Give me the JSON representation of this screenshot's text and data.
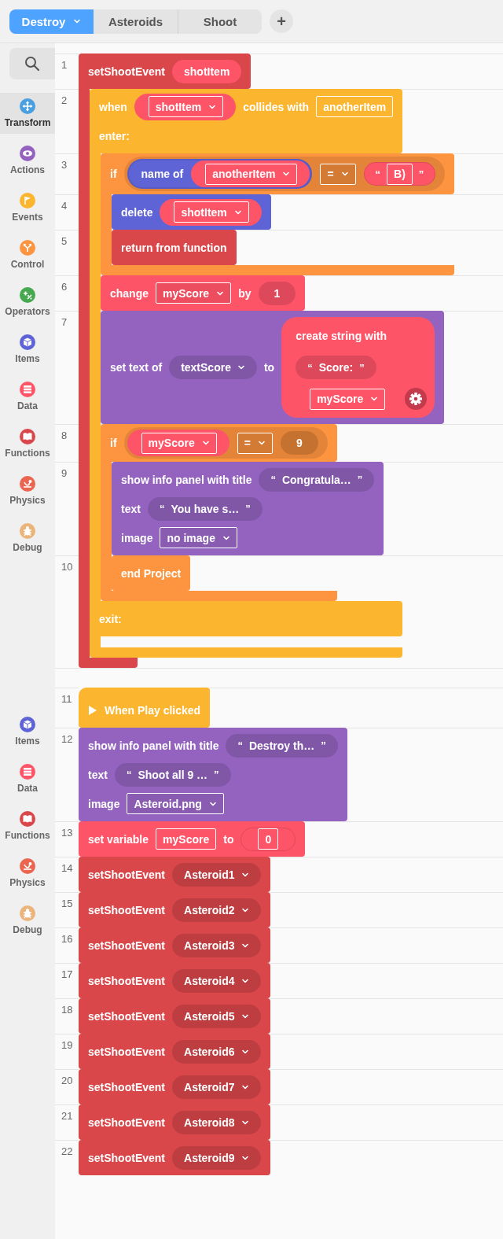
{
  "tabs": [
    {
      "label": "Destroy",
      "selected": true,
      "menu": true
    },
    {
      "label": "Asteroids",
      "selected": false,
      "menu": false
    },
    {
      "label": "Shoot",
      "selected": false,
      "menu": false
    }
  ],
  "add_tab": "+",
  "sidebar": {
    "items": [
      {
        "label": "Transform",
        "kind": "transform",
        "color": "#4a9fe0",
        "selected": true
      },
      {
        "label": "Actions",
        "kind": "actions",
        "color": "#9463c0",
        "selected": false
      },
      {
        "label": "Events",
        "kind": "events",
        "color": "#fbb52e",
        "selected": false
      },
      {
        "label": "Control",
        "kind": "control",
        "color": "#fd9440",
        "selected": false
      },
      {
        "label": "Operators",
        "kind": "operators",
        "color": "#46a84f",
        "selected": false
      },
      {
        "label": "Items",
        "kind": "items",
        "color": "#5e63d6",
        "selected": false
      },
      {
        "label": "Data",
        "kind": "data",
        "color": "#fe5468",
        "selected": false
      },
      {
        "label": "Functions",
        "kind": "functions",
        "color": "#d9474b",
        "selected": false
      },
      {
        "label": "Physics",
        "kind": "physics",
        "color": "#ea6650",
        "selected": false
      },
      {
        "label": "Debug",
        "kind": "debug",
        "color": "#eab47a",
        "selected": false
      }
    ],
    "more_items": [
      {
        "label": "Items",
        "kind": "items",
        "color": "#5e63d6",
        "selected": false
      },
      {
        "label": "Data",
        "kind": "data",
        "color": "#fe5468",
        "selected": false
      },
      {
        "label": "Functions",
        "kind": "functions",
        "color": "#d9474b",
        "selected": false
      },
      {
        "label": "Physics",
        "kind": "physics",
        "color": "#ea6650",
        "selected": false
      },
      {
        "label": "Debug",
        "kind": "debug",
        "color": "#eab47a",
        "selected": false
      }
    ]
  },
  "scripts": [
    {
      "blocks": [
        {
          "line": "1",
          "color": "#d9474b",
          "kind": "definition",
          "rows": [
            [
              {
                "kind": "label",
                "text": "setShootEvent"
              },
              {
                "kind": "param",
                "text": "shotItem"
              }
            ]
          ],
          "body": [
            {
              "line": "2",
              "color": "#fbb52e",
              "kind": "container",
              "rows": [
                [
                  {
                    "kind": "label",
                    "text": "when"
                  },
                  {
                    "kind": "var_dropdown",
                    "text": "shotItem"
                  },
                  {
                    "kind": "label",
                    "text": "collides with"
                  },
                  {
                    "kind": "field",
                    "text": "anotherItem"
                  }
                ],
                [
                  {
                    "kind": "label",
                    "text": "enter:"
                  }
                ]
              ],
              "body": [
                {
                  "line": "3",
                  "color": "#fd9440",
                  "kind": "container",
                  "rows": [
                    [
                      {
                        "kind": "label",
                        "text": "if"
                      },
                      {
                        "kind": "condition",
                        "parts": [
                          {
                            "kind": "reporter",
                            "color": "#5e63d6",
                            "parts": [
                              {
                                "kind": "label",
                                "text": "name of"
                              },
                              {
                                "kind": "var_dropdown",
                                "text": "anotherItem"
                              }
                            ]
                          },
                          {
                            "kind": "dropdown",
                            "text": "="
                          },
                          {
                            "kind": "string_field",
                            "quote_open": "“",
                            "text": "B)",
                            "quote_close": "”"
                          }
                        ]
                      }
                    ]
                  ],
                  "body": [
                    {
                      "line": "4",
                      "color": "#5e63d6",
                      "kind": "statement",
                      "rows": [
                        [
                          {
                            "kind": "label",
                            "text": "delete"
                          },
                          {
                            "kind": "var_dropdown",
                            "text": "shotItem"
                          }
                        ]
                      ]
                    },
                    {
                      "line": "5",
                      "color": "#d9474b",
                      "kind": "statement",
                      "rows": [
                        [
                          {
                            "kind": "label",
                            "text": "return from function"
                          }
                        ]
                      ]
                    }
                  ]
                },
                {
                  "line": "6",
                  "color": "#fe5468",
                  "kind": "statement",
                  "rows": [
                    [
                      {
                        "kind": "label",
                        "text": "change"
                      },
                      {
                        "kind": "dropdown",
                        "text": "myScore"
                      },
                      {
                        "kind": "label",
                        "text": "by"
                      },
                      {
                        "kind": "number",
                        "text": "1"
                      }
                    ]
                  ]
                },
                {
                  "line": "7",
                  "color": "#9463c0",
                  "kind": "statement",
                  "rows": [
                    [
                      {
                        "kind": "label",
                        "text": "set text of"
                      },
                      {
                        "kind": "dropdown_pill",
                        "text": "textScore"
                      },
                      {
                        "kind": "label",
                        "text": "to"
                      },
                      {
                        "kind": "reporter_rows",
                        "color": "#fe5468",
                        "rows": [
                          [
                            {
                              "kind": "label",
                              "text": "create string with"
                            }
                          ],
                          [
                            {
                              "kind": "string",
                              "quote_open": "“",
                              "text": "Score:",
                              "quote_close": "”"
                            }
                          ],
                          [
                            {
                              "kind": "var_dropdown",
                              "text": "myScore"
                            },
                            {
                              "kind": "gear"
                            }
                          ]
                        ]
                      }
                    ]
                  ]
                },
                {
                  "line": "8",
                  "color": "#fd9440",
                  "kind": "container",
                  "rows": [
                    [
                      {
                        "kind": "label",
                        "text": "if"
                      },
                      {
                        "kind": "condition",
                        "parts": [
                          {
                            "kind": "var_dropdown",
                            "text": "myScore"
                          },
                          {
                            "kind": "dropdown",
                            "text": "="
                          },
                          {
                            "kind": "number",
                            "text": "9"
                          }
                        ]
                      }
                    ]
                  ],
                  "body": [
                    {
                      "line": "9",
                      "color": "#9463c0",
                      "kind": "statement",
                      "rows": [
                        [
                          {
                            "kind": "label",
                            "text": "show info panel with title"
                          },
                          {
                            "kind": "string",
                            "quote_open": "“",
                            "text": "Congratula…",
                            "quote_close": "”"
                          }
                        ],
                        [
                          {
                            "kind": "label",
                            "text": "text"
                          },
                          {
                            "kind": "string",
                            "quote_open": "“",
                            "text": "You have s…",
                            "quote_close": "”"
                          }
                        ],
                        [
                          {
                            "kind": "label",
                            "text": "image"
                          },
                          {
                            "kind": "dropdown",
                            "text": "no image"
                          }
                        ]
                      ]
                    },
                    {
                      "line": "10",
                      "color": "#fd9440",
                      "kind": "statement",
                      "rows": [
                        [
                          {
                            "kind": "label",
                            "text": "end Project"
                          }
                        ]
                      ]
                    }
                  ]
                }
              ],
              "sections": [
                {
                  "rows": [
                    [
                      {
                        "kind": "label",
                        "text": "exit:"
                      }
                    ]
                  ]
                }
              ]
            }
          ]
        }
      ]
    },
    {
      "blocks": [
        {
          "line": "11",
          "color": "#fbb52e",
          "kind": "hat",
          "rows": [
            [
              {
                "kind": "play"
              },
              {
                "kind": "label",
                "text": "When Play clicked"
              }
            ]
          ]
        },
        {
          "line": "12",
          "color": "#9463c0",
          "kind": "statement",
          "rows": [
            [
              {
                "kind": "label",
                "text": "show info panel with title"
              },
              {
                "kind": "string",
                "quote_open": "“",
                "text": "Destroy th…",
                "quote_close": "”"
              }
            ],
            [
              {
                "kind": "label",
                "text": "text"
              },
              {
                "kind": "string",
                "quote_open": "“",
                "text": "Shoot all 9 …",
                "quote_close": "”"
              }
            ],
            [
              {
                "kind": "label",
                "text": "image"
              },
              {
                "kind": "dropdown",
                "text": "Asteroid.png"
              }
            ]
          ]
        },
        {
          "line": "13",
          "color": "#fe5468",
          "kind": "statement",
          "rows": [
            [
              {
                "kind": "label",
                "text": "set variable"
              },
              {
                "kind": "field",
                "text": "myScore"
              },
              {
                "kind": "label",
                "text": "to"
              },
              {
                "kind": "number_field",
                "text": "0"
              }
            ]
          ]
        },
        {
          "line": "14",
          "color": "#d9474b",
          "kind": "statement",
          "rows": [
            [
              {
                "kind": "label",
                "text": "setShootEvent"
              },
              {
                "kind": "dropdown_pill",
                "text": "Asteroid1"
              }
            ]
          ]
        },
        {
          "line": "15",
          "color": "#d9474b",
          "kind": "statement",
          "rows": [
            [
              {
                "kind": "label",
                "text": "setShootEvent"
              },
              {
                "kind": "dropdown_pill",
                "text": "Asteroid2"
              }
            ]
          ]
        },
        {
          "line": "16",
          "color": "#d9474b",
          "kind": "statement",
          "rows": [
            [
              {
                "kind": "label",
                "text": "setShootEvent"
              },
              {
                "kind": "dropdown_pill",
                "text": "Asteroid3"
              }
            ]
          ]
        },
        {
          "line": "17",
          "color": "#d9474b",
          "kind": "statement",
          "rows": [
            [
              {
                "kind": "label",
                "text": "setShootEvent"
              },
              {
                "kind": "dropdown_pill",
                "text": "Asteroid4"
              }
            ]
          ]
        },
        {
          "line": "18",
          "color": "#d9474b",
          "kind": "statement",
          "rows": [
            [
              {
                "kind": "label",
                "text": "setShootEvent"
              },
              {
                "kind": "dropdown_pill",
                "text": "Asteroid5"
              }
            ]
          ]
        },
        {
          "line": "19",
          "color": "#d9474b",
          "kind": "statement",
          "rows": [
            [
              {
                "kind": "label",
                "text": "setShootEvent"
              },
              {
                "kind": "dropdown_pill",
                "text": "Asteroid6"
              }
            ]
          ]
        },
        {
          "line": "20",
          "color": "#d9474b",
          "kind": "statement",
          "rows": [
            [
              {
                "kind": "label",
                "text": "setShootEvent"
              },
              {
                "kind": "dropdown_pill",
                "text": "Asteroid7"
              }
            ]
          ]
        },
        {
          "line": "21",
          "color": "#d9474b",
          "kind": "statement",
          "rows": [
            [
              {
                "kind": "label",
                "text": "setShootEvent"
              },
              {
                "kind": "dropdown_pill",
                "text": "Asteroid8"
              }
            ]
          ]
        },
        {
          "line": "22",
          "color": "#d9474b",
          "kind": "statement",
          "rows": [
            [
              {
                "kind": "label",
                "text": "setShootEvent"
              },
              {
                "kind": "dropdown_pill",
                "text": "Asteroid9"
              }
            ]
          ]
        }
      ]
    }
  ]
}
